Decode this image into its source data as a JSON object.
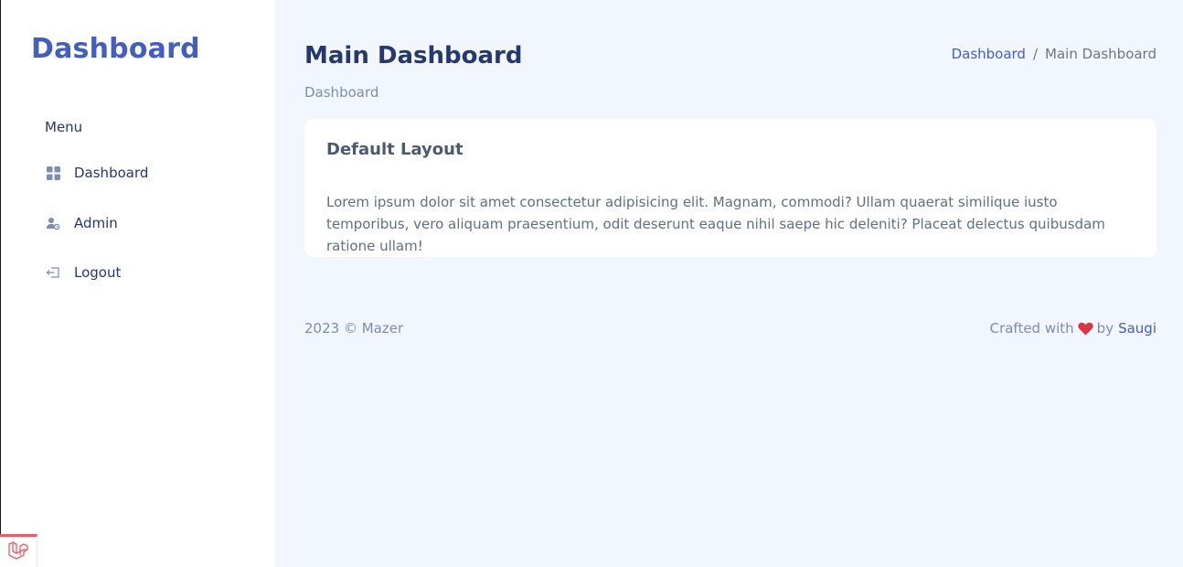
{
  "sidebar": {
    "brand": "Dashboard",
    "menu_title": "Menu",
    "items": [
      {
        "label": "Dashboard",
        "icon": "grid-icon"
      },
      {
        "label": "Admin",
        "icon": "user-gear-icon"
      },
      {
        "label": "Logout",
        "icon": "logout-icon"
      }
    ]
  },
  "header": {
    "title": "Main Dashboard",
    "subtitle": "Dashboard",
    "breadcrumb": [
      "Dashboard",
      "Main Dashboard"
    ],
    "breadcrumb_separator": "/"
  },
  "card": {
    "title": "Default Layout",
    "body": "Lorem ipsum dolor sit amet consectetur adipisicing elit. Magnam, commodi? Ullam quaerat similique iusto temporibus, vero aliquam praesentium, odit deserunt eaque nihil saepe hic deleniti? Placeat delectus quibusdam ratione ullam!"
  },
  "footer": {
    "copyright": "2023 © Mazer",
    "crafted_prefix": "Crafted with",
    "crafted_by": "by",
    "author": "Saugi"
  },
  "colors": {
    "primary": "#435ebe",
    "heading": "#25396f",
    "muted": "#7c8db5",
    "background": "#f2f7ff",
    "heart": "#dc3545",
    "laravel_red": "#f05a66"
  }
}
